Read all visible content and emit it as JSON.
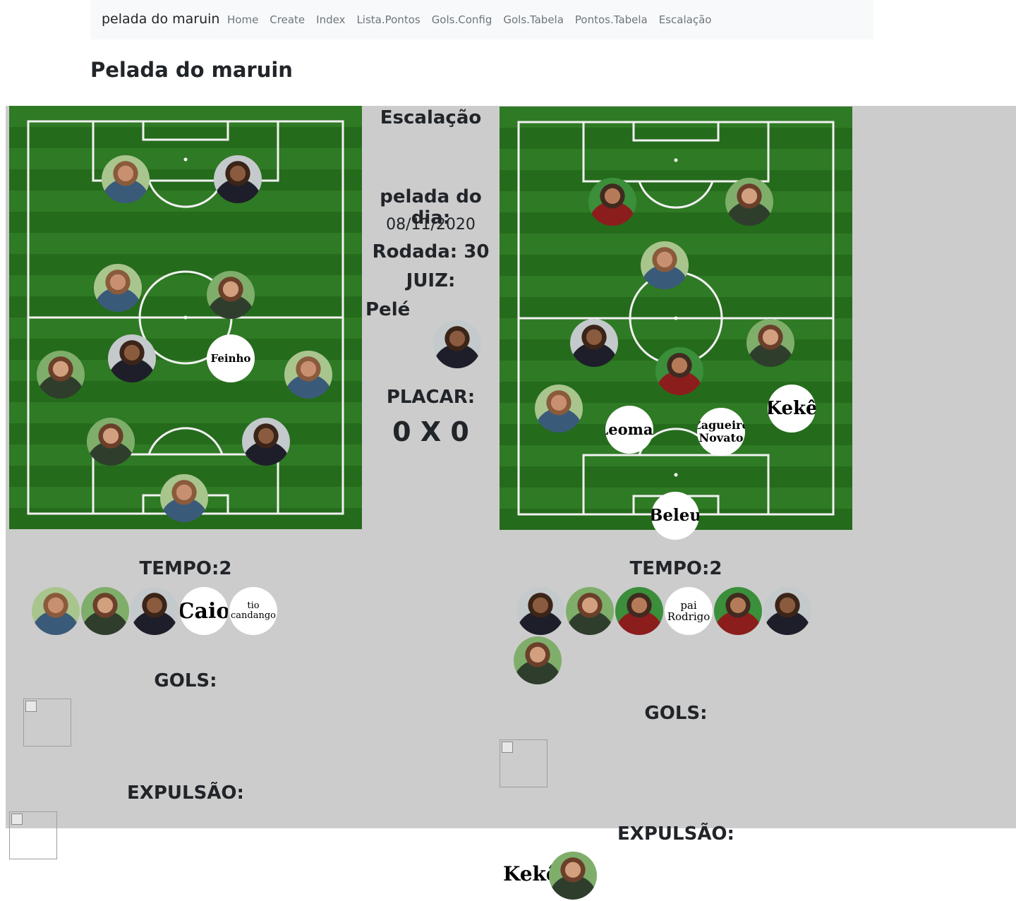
{
  "navbar": {
    "brand": "pelada do maruin",
    "links": [
      "Home",
      "Create",
      "Index",
      "Lista.Pontos",
      "Gols.Config",
      "Gols.Tabela",
      "Pontos.Tabela",
      "Escalação"
    ]
  },
  "page_title": "Pelada do maruin",
  "center": {
    "title": "Escalação",
    "pelada_label": "pelada do dia:",
    "date": "08/11/2020",
    "rodada": "Rodada: 30",
    "juiz_label": "JUIZ:",
    "juiz_name": "Pelé",
    "placar_label": "PLACAR:",
    "placar": "0 X 0"
  },
  "team_left": {
    "field_labels": [
      "Feinho"
    ],
    "tempo": "TEMPO:2",
    "bench_labels": [
      "Caio",
      "tio candango"
    ],
    "gols_label": "GOLS:",
    "expulsao_label": "EXPULSÃO:"
  },
  "team_right": {
    "field_labels": [
      "Kekê",
      "Leomar",
      "Zagueiro Novato",
      "Beleu"
    ],
    "tempo": "TEMPO:2",
    "bench_labels": [
      "pai Rodrigo"
    ],
    "gols_label": "GOLS:",
    "expulsao_label": "EXPULSÃO:",
    "expelled_name": "Kekê"
  }
}
